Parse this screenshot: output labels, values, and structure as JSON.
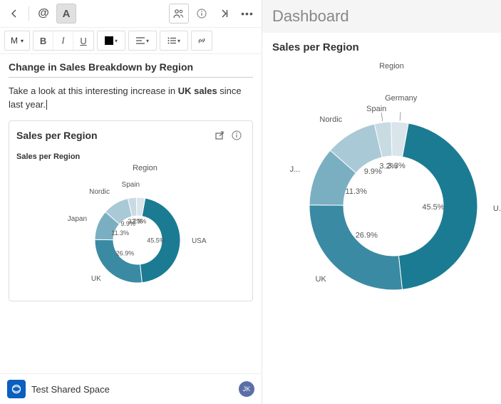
{
  "toolbar": {
    "m_label": "M",
    "bold": "B",
    "italic": "I",
    "underline": "U"
  },
  "editor": {
    "heading": "Change in Sales Breakdown by Region",
    "para_before": "Take a look at this interesting increase in ",
    "para_bold": "UK sales",
    "para_after": " since last year."
  },
  "card": {
    "title": "Sales per Region",
    "subtitle": "Sales per Region",
    "legend": "Region"
  },
  "dashboard": {
    "title": "Dashboard",
    "card_title": "Sales per Region",
    "legend": "Region"
  },
  "footer": {
    "space": "Test Shared Space",
    "avatar": "JK"
  },
  "chart_data": {
    "type": "pie",
    "title": "Sales per Region",
    "legend_title": "Region",
    "series": [
      {
        "name": "USA",
        "value": 45.5,
        "color": "#1b7b93",
        "label": "45.5%"
      },
      {
        "name": "UK",
        "value": 26.9,
        "color": "#3b8aa3",
        "label": "26.9%"
      },
      {
        "name": "Japan",
        "value": 11.3,
        "color": "#7aafc2",
        "label": "11.3%"
      },
      {
        "name": "Nordic",
        "value": 9.9,
        "color": "#a9c9d6",
        "label": "9.9%"
      },
      {
        "name": "Spain",
        "value": 3.2,
        "color": "#c9dbe2",
        "label": "3.2%"
      },
      {
        "name": "Germany",
        "value": 3.3,
        "color": "#d9e5ea",
        "label": "3.3%"
      }
    ]
  }
}
